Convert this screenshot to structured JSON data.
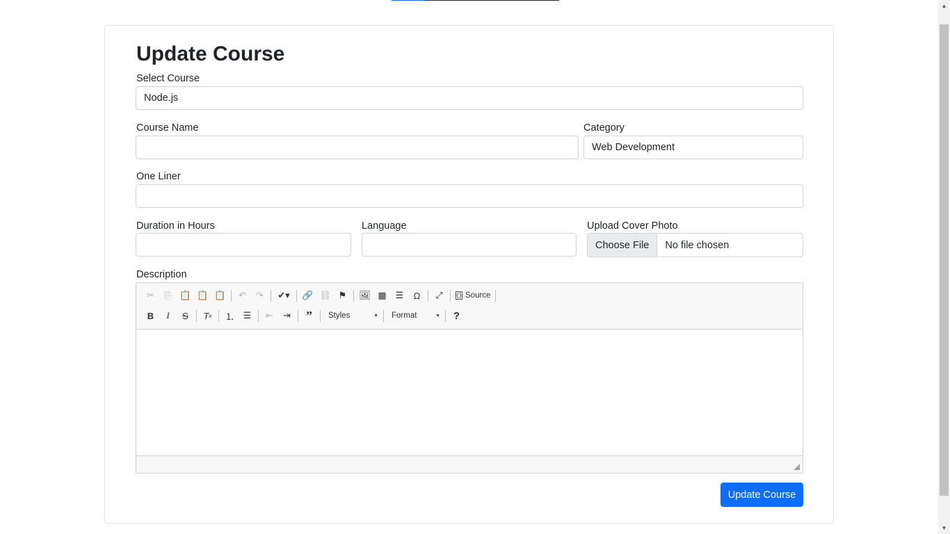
{
  "page": {
    "title": "Update Course",
    "progress_fraction": 0.2
  },
  "form": {
    "select_course": {
      "label": "Select Course",
      "value": "Node.js"
    },
    "course_name": {
      "label": "Course Name",
      "value": ""
    },
    "category": {
      "label": "Category",
      "value": "Web Development"
    },
    "one_liner": {
      "label": "One Liner",
      "value": ""
    },
    "duration": {
      "label": "Duration in Hours",
      "value": ""
    },
    "language": {
      "label": "Language",
      "value": ""
    },
    "cover_photo": {
      "label": "Upload Cover Photo",
      "button": "Choose File",
      "status": "No file chosen"
    },
    "description": {
      "label": "Description",
      "toolbar": {
        "source_label": "Source",
        "styles_label": "Styles",
        "format_label": "Format",
        "strike_glyph": "S",
        "help_glyph": "?"
      }
    },
    "submit_label": "Update Course"
  },
  "colors": {
    "primary": "#0d6efd",
    "border": "#ced4da",
    "toolbar_bg": "#f8f8f8"
  }
}
